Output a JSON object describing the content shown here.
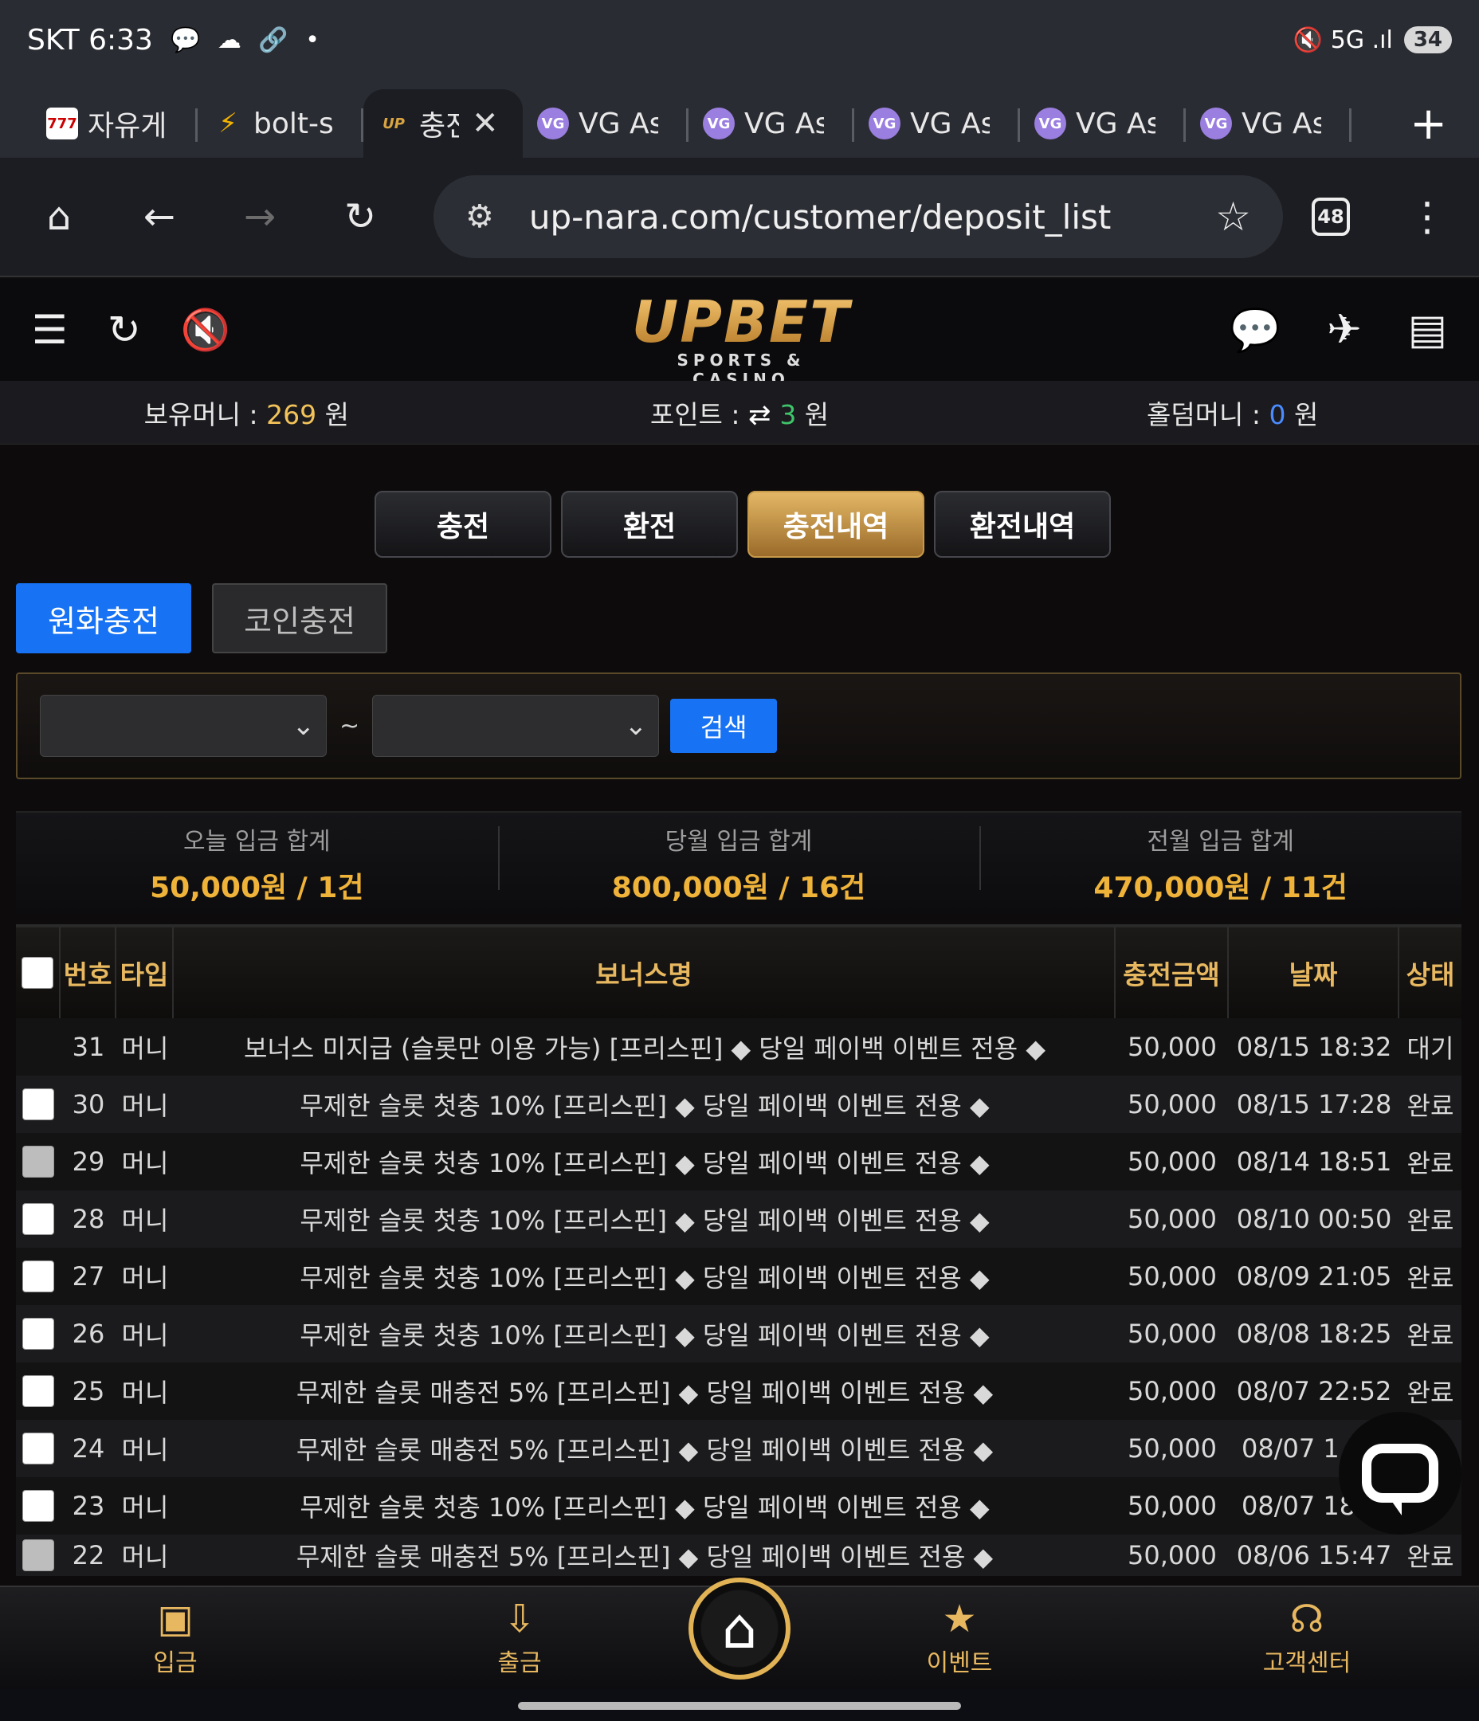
{
  "statusbar": {
    "time": "SKT 6:33",
    "icons": "💬 ☁ 🔗 •",
    "right_icons": "🔇 5G .ıl",
    "battery": "34"
  },
  "tabs": [
    {
      "title": "자유게",
      "favicon": "slot-icon"
    },
    {
      "title": "bolt-s",
      "favicon": "bolt-icon"
    },
    {
      "title": "충전",
      "favicon": "upbet-icon"
    },
    {
      "title": "VG As",
      "favicon": "vg-icon"
    },
    {
      "title": "VG As",
      "favicon": "vg-icon"
    },
    {
      "title": "VG As",
      "favicon": "vg-icon"
    },
    {
      "title": "VG As",
      "favicon": "vg-icon"
    },
    {
      "title": "VG As",
      "favicon": "vg-icon"
    }
  ],
  "browser": {
    "url": "up-nara.com/customer/deposit_list",
    "tab_count": "48"
  },
  "site": {
    "logo": "UPBET",
    "tagline": "SPORTS & CASINO"
  },
  "balance": {
    "money_label": "보유머니 : ",
    "money_value": "269",
    "money_unit": " 원",
    "point_label": "포인트 : ",
    "point_value": "3",
    "point_unit": " 원",
    "holdem_label": "홀덤머니 : ",
    "holdem_value": "0",
    "holdem_unit": " 원"
  },
  "mode_tabs": [
    "충전",
    "환전",
    "충전내역",
    "환전내역"
  ],
  "sub_tabs": [
    "원화충전",
    "코인충전"
  ],
  "search": {
    "button": "검색",
    "separator": "~"
  },
  "summary": [
    {
      "label": "오늘 입금 합계",
      "value": "50,000원 / 1건"
    },
    {
      "label": "당월 입금 합계",
      "value": "800,000원 / 16건"
    },
    {
      "label": "전월 입금 합계",
      "value": "470,000원 / 11건"
    }
  ],
  "table": {
    "headers": {
      "no": "번호",
      "type": "타입",
      "name": "보너스명",
      "amount": "충전금액",
      "date": "날짜",
      "status": "상태"
    },
    "rows": [
      {
        "no": "31",
        "type": "머니",
        "name": "보너스 미지급 (슬롯만 이용 가능) [프리스핀] ◆ 당일 페이백 이벤트 전용 ◆",
        "amount": "50,000",
        "date": "08/15 18:32",
        "status": "대기"
      },
      {
        "no": "30",
        "type": "머니",
        "name": "무제한 슬롯 첫충 10% [프리스핀] ◆ 당일 페이백 이벤트 전용 ◆",
        "amount": "50,000",
        "date": "08/15 17:28",
        "status": "완료"
      },
      {
        "no": "29",
        "type": "머니",
        "name": "무제한 슬롯 첫충 10% [프리스핀] ◆ 당일 페이백 이벤트 전용 ◆",
        "amount": "50,000",
        "date": "08/14 18:51",
        "status": "완료"
      },
      {
        "no": "28",
        "type": "머니",
        "name": "무제한 슬롯 첫충 10% [프리스핀] ◆ 당일 페이백 이벤트 전용 ◆",
        "amount": "50,000",
        "date": "08/10 00:50",
        "status": "완료"
      },
      {
        "no": "27",
        "type": "머니",
        "name": "무제한 슬롯 첫충 10% [프리스핀] ◆ 당일 페이백 이벤트 전용 ◆",
        "amount": "50,000",
        "date": "08/09 21:05",
        "status": "완료"
      },
      {
        "no": "26",
        "type": "머니",
        "name": "무제한 슬롯 첫충 10% [프리스핀] ◆ 당일 페이백 이벤트 전용 ◆",
        "amount": "50,000",
        "date": "08/08 18:25",
        "status": "완료"
      },
      {
        "no": "25",
        "type": "머니",
        "name": "무제한 슬롯 매충전 5% [프리스핀] ◆ 당일 페이백 이벤트 전용 ◆",
        "amount": "50,000",
        "date": "08/07 22:52",
        "status": "완료"
      },
      {
        "no": "24",
        "type": "머니",
        "name": "무제한 슬롯 매충전 5% [프리스핀] ◆ 당일 페이백 이벤트 전용 ◆",
        "amount": "50,000",
        "date": "08/07 1",
        "status": ""
      },
      {
        "no": "23",
        "type": "머니",
        "name": "무제한 슬롯 첫충 10% [프리스핀] ◆ 당일 페이백 이벤트 전용 ◆",
        "amount": "50,000",
        "date": "08/07 18",
        "status": ""
      },
      {
        "no": "22",
        "type": "머니",
        "name": "무제한 슬롯 매충전 5% [프리스핀] ◆ 당일 페이백 이벤트 전용 ◆",
        "amount": "50,000",
        "date": "08/06 15:47",
        "status": "완료"
      }
    ]
  },
  "bottom_nav": [
    "입금",
    "출금",
    "이벤트",
    "고객센터"
  ],
  "colors": {
    "gold": "#e8b860",
    "accent_blue": "#1773f3",
    "amount_orange": "#f0b33a"
  }
}
